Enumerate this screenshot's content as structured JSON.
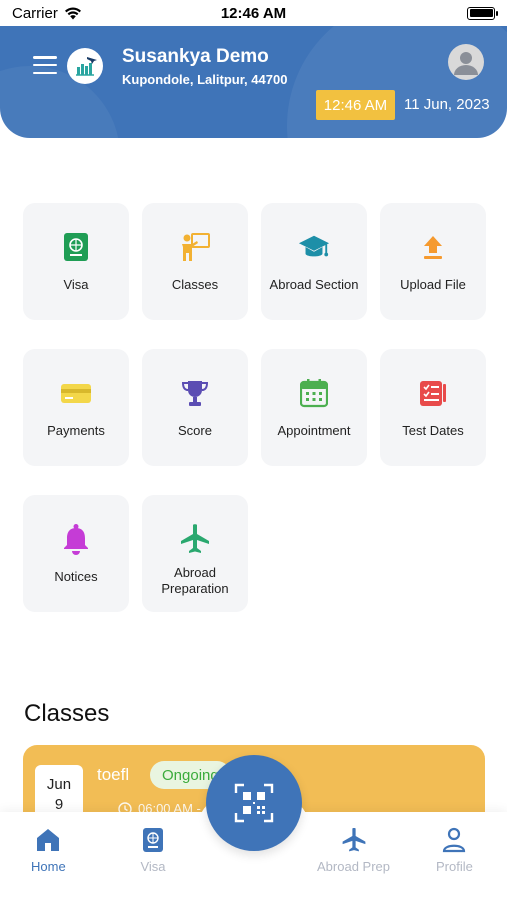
{
  "status_bar": {
    "carrier": "Carrier",
    "time": "12:46 AM"
  },
  "header": {
    "user_name": "Susankya Demo",
    "address": "Kupondole, Lalitpur, 44700",
    "time": "12:46 AM",
    "date": "11 Jun, 2023"
  },
  "tiles": [
    {
      "label": "Visa",
      "icon": "passport-icon",
      "color": "#1f9d55"
    },
    {
      "label": "Classes",
      "icon": "teacher-board-icon",
      "color": "#f2b132"
    },
    {
      "label": "Abroad Section",
      "icon": "graduation-cap-icon",
      "color": "#1d8fa8"
    },
    {
      "label": "Upload File",
      "icon": "upload-icon",
      "color": "#f59a2f"
    },
    {
      "label": "Payments",
      "icon": "credit-card-icon",
      "color": "#f3d74a"
    },
    {
      "label": "Score",
      "icon": "trophy-icon",
      "color": "#5b4db3"
    },
    {
      "label": "Appointment",
      "icon": "calendar-icon",
      "color": "#4caf50"
    },
    {
      "label": "Test Dates",
      "icon": "checklist-icon",
      "color": "#e84b4b"
    },
    {
      "label": "Notices",
      "icon": "bell-icon",
      "color": "#c53cd6"
    },
    {
      "label": "Abroad Preparation",
      "icon": "airplane-icon",
      "color": "#2aa86f"
    }
  ],
  "classes_section": {
    "title": "Classes",
    "card": {
      "month": "Jun",
      "day": "9",
      "name": "toefl",
      "status": "Ongoing",
      "time": "06:00 AM -"
    }
  },
  "tabbar": {
    "home": "Home",
    "visa": "Visa",
    "abroad_prep": "Abroad Prep",
    "profile": "Profile"
  },
  "colors": {
    "primary": "#3f74b8",
    "accent": "#f2c140",
    "card": "#f2bd55"
  }
}
